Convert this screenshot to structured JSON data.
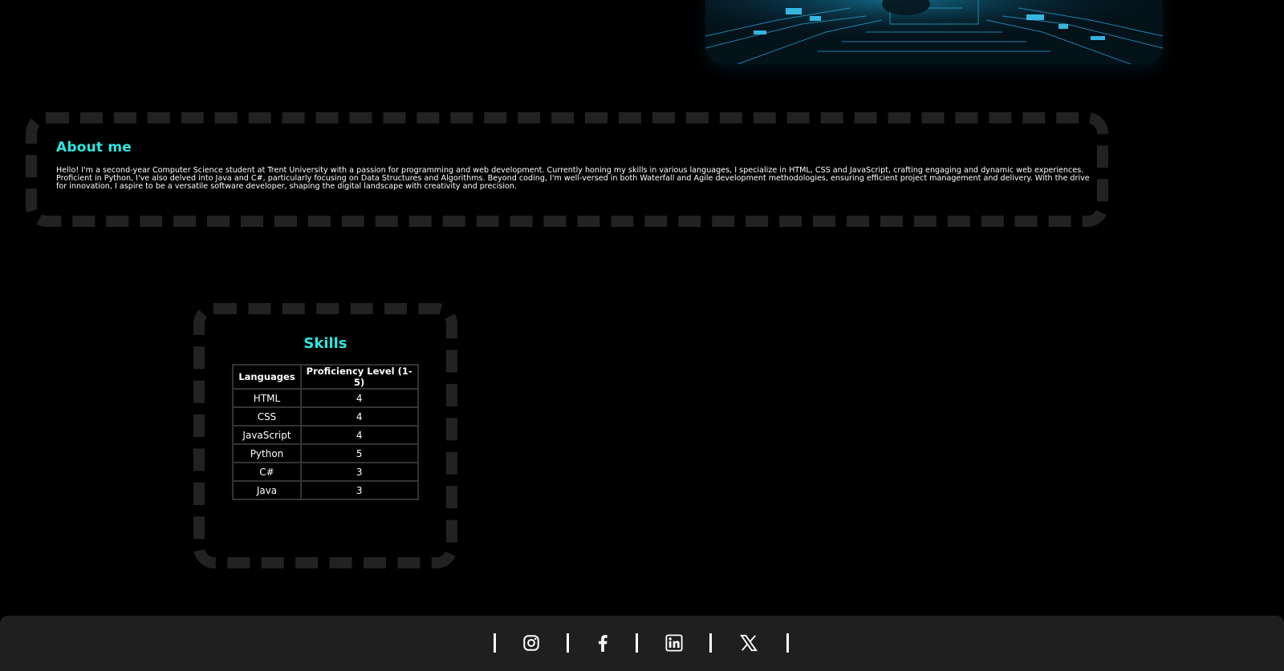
{
  "about": {
    "title": "About me",
    "text": "Hello! I'm a second-year Computer Science student at Trent University with a passion for programming and web development. Currently honing my skills in various languages, I specialize in HTML, CSS and JavaScript, crafting engaging and dynamic web experiences. Proficient in Python, I've also delved into Java and C#, particularly focusing on Data Structures and Algorithms. Beyond coding, I'm well-versed in both Waterfall and Agile development methodologies, ensuring efficient project management and delivery. With the drive for innovation, I aspire to be a versatile software developer, shaping the digital landscape with creativity and precision."
  },
  "skills": {
    "title": "Skills",
    "columns": [
      "Languages",
      "Proficiency Level (1-5)"
    ],
    "rows": [
      {
        "language": "HTML",
        "level": "4"
      },
      {
        "language": "CSS",
        "level": "4"
      },
      {
        "language": "JavaScript",
        "level": "4"
      },
      {
        "language": "Python",
        "level": "5"
      },
      {
        "language": "C#",
        "level": "3"
      },
      {
        "language": "Java",
        "level": "3"
      }
    ]
  },
  "footer": {
    "social_icons": [
      "instagram-icon",
      "facebook-icon",
      "linkedin-icon",
      "x-icon"
    ]
  },
  "colors": {
    "accent": "#2ee6e0",
    "background": "#000000",
    "border": "#222222",
    "footer": "#1f1f1f"
  }
}
